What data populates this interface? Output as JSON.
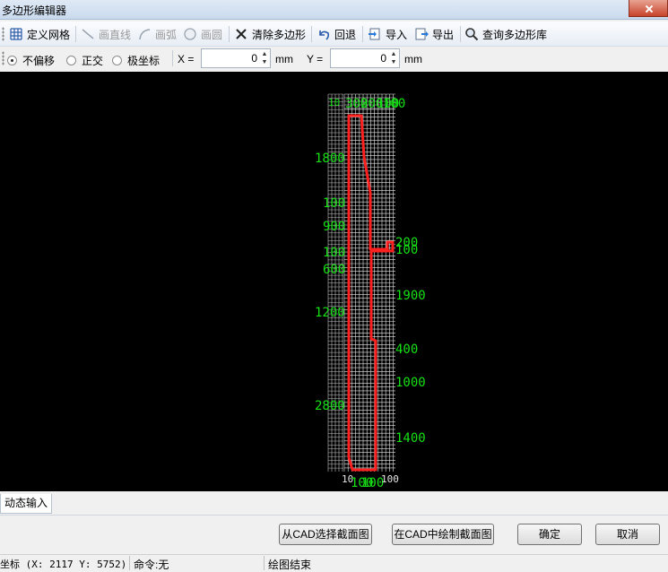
{
  "window": {
    "title": "多边形编辑器"
  },
  "toolbar": {
    "define_grid": "定义网格",
    "draw_line": "画直线",
    "draw_arc": "画弧",
    "draw_circle": "画圆",
    "clear_polygon": "清除多边形",
    "undo": "回退",
    "import": "导入",
    "export": "导出",
    "query_library": "查询多边形库"
  },
  "options": {
    "mode_no_offset": "不偏移",
    "mode_ortho": "正交",
    "mode_polar": "极坐标",
    "selected_mode": "不偏移",
    "x_label": "X =",
    "x_value": "0",
    "y_label": "Y =",
    "y_value": "0",
    "unit": "mm"
  },
  "canvas": {
    "background": "#000000",
    "grid_color": "#e6e6e6",
    "polygon_color": "#ff2020",
    "label_color": "#17e017",
    "left_labels": [
      "1800",
      "100",
      "900",
      "100",
      "600",
      "1200",
      "2800"
    ],
    "right_labels": [
      "200",
      "100",
      "1900",
      "400",
      "1000",
      "1400"
    ],
    "top_labels": [
      "10",
      "300",
      "200",
      "100",
      "100"
    ],
    "bottom_labels": [
      "10",
      "100",
      "100",
      "100"
    ]
  },
  "tabs": {
    "dynamic_input": "动态输入"
  },
  "buttons": {
    "select_from_cad": "从CAD选择截面图",
    "draw_in_cad": "在CAD中绘制截面图",
    "ok": "确定",
    "cancel": "取消"
  },
  "status": {
    "coord_text": "坐标 (X: 2117 Y: 5752)",
    "command_text": "命令:无",
    "message_text": "绘图结束"
  }
}
